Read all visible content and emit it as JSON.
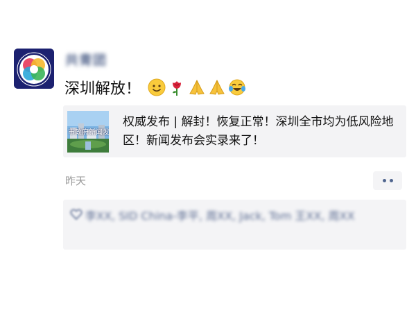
{
  "post": {
    "username": "共青团",
    "text": "深圳解放！",
    "emojis": [
      "smiling-face-emoji",
      "rose-emoji",
      "praying-hands-emoji",
      "praying-hands-emoji",
      "tears-of-joy-emoji"
    ]
  },
  "share_card": {
    "thumb_text": "市政府新闻发",
    "title": "权威发布 | 解封！恢复正常！深圳全市均为低风险地区！新闻发布会实录来了！"
  },
  "meta": {
    "time": "昨天",
    "more_icon": "more-dots-icon"
  },
  "likes": {
    "icon": "heart-icon",
    "text": "李XX, SID China-李平, 周XX, Jack, Tom 王XX, 周XX"
  },
  "colors": {
    "name_link": "#5a6b91",
    "card_bg": "#f3f3f5",
    "time": "#999999"
  }
}
